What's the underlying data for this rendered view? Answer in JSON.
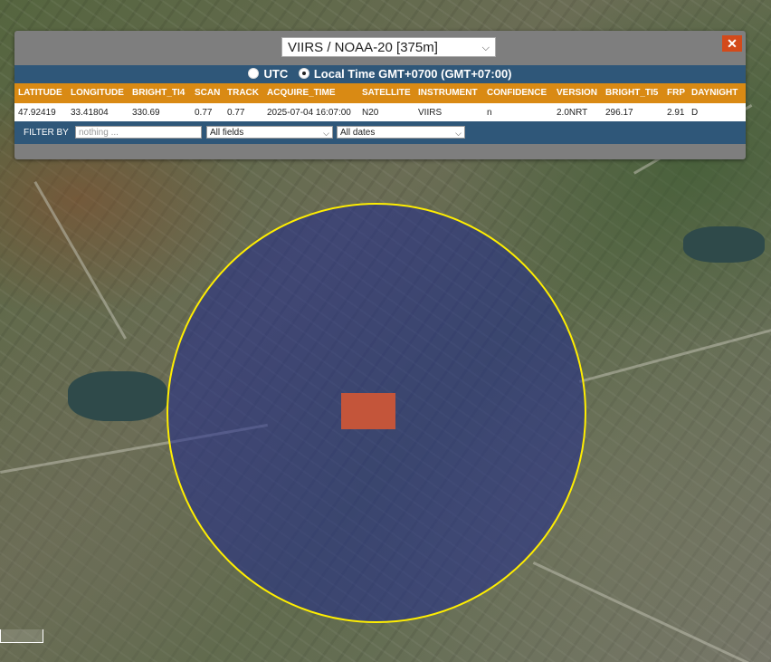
{
  "dataset": {
    "selected": "VIIRS / NOAA-20 [375m]"
  },
  "close_icon_glyph": "✕",
  "timezone": {
    "utc_label": "UTC",
    "local_label": "Local Time GMT+0700 (GMT+07:00)",
    "selected": "local"
  },
  "table": {
    "columns": [
      "LATITUDE",
      "LONGITUDE",
      "BRIGHT_TI4",
      "SCAN",
      "TRACK",
      "ACQUIRE_TIME",
      "SATELLITE",
      "INSTRUMENT",
      "CONFIDENCE",
      "VERSION",
      "BRIGHT_TI5",
      "FRP",
      "DAYNIGHT"
    ],
    "rows": [
      [
        "47.92419",
        "33.41804",
        "330.69",
        "0.77",
        "0.77",
        "2025-07-04 16:07:00",
        "N20",
        "VIIRS",
        "n",
        "2.0NRT",
        "296.17",
        "2.91",
        "D"
      ]
    ]
  },
  "filter": {
    "label": "FILTER BY",
    "placeholder": "nothing ...",
    "field_select": "All fields",
    "date_select": "All dates"
  },
  "colors": {
    "header_bar": "#2f5779",
    "table_header": "#d98a14",
    "close_button": "#d34a1a",
    "circle_border": "#ffee00",
    "circle_fill": "#1e288c",
    "hotspot": "#c4553a"
  },
  "icons": {
    "close": "close-icon",
    "dropdown": "chevron-down-icon"
  }
}
